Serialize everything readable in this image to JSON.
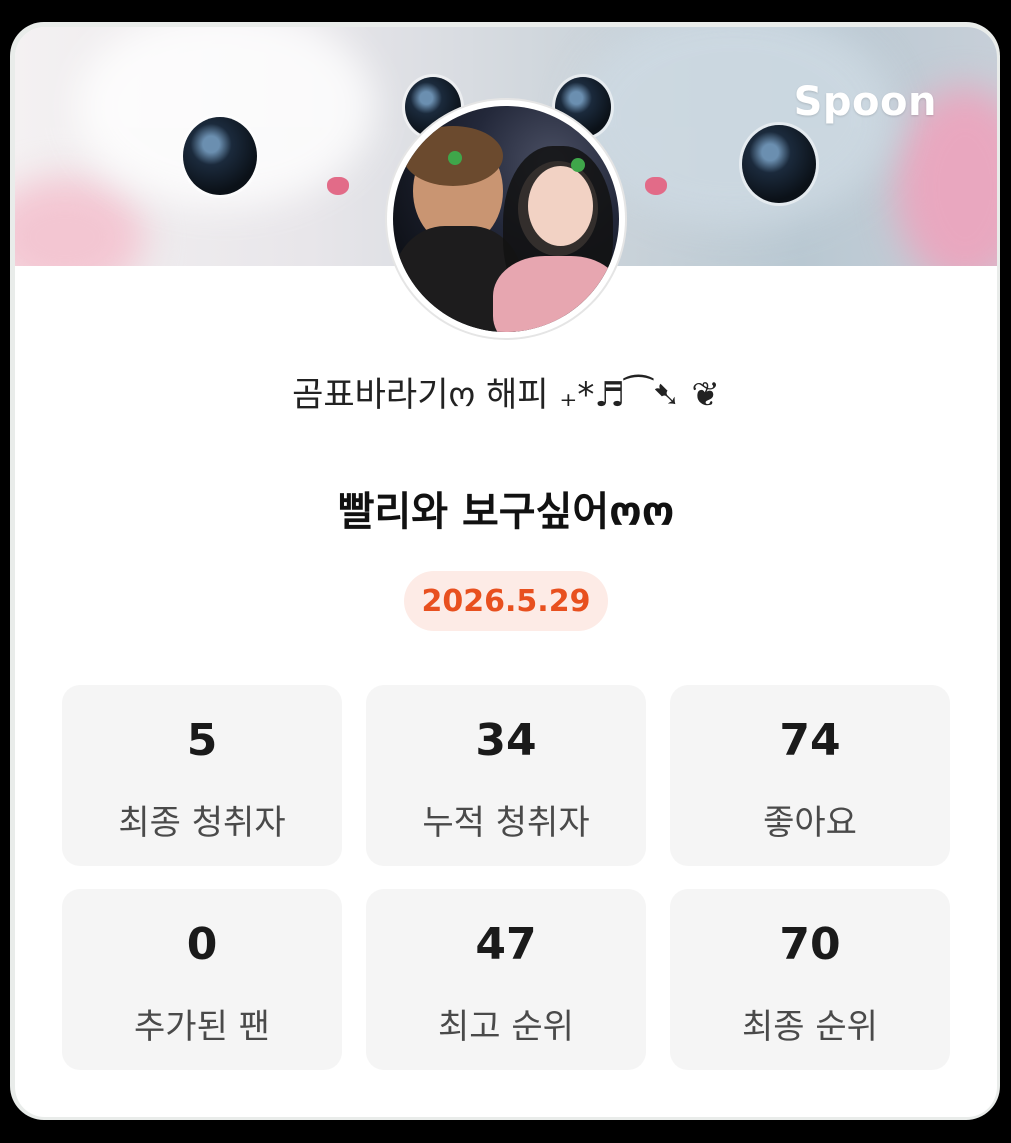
{
  "brand": {
    "logo_text": "Spoon"
  },
  "broadcast": {
    "host_name": "곰표바라기ო 해피 ₊*♬⁀➷ ❦",
    "title": "빨리와 보구싶어ოო",
    "date": "2026.5.29"
  },
  "stats": [
    {
      "value": "5",
      "label": "최종 청취자"
    },
    {
      "value": "34",
      "label": "누적 청취자"
    },
    {
      "value": "74",
      "label": "좋아요"
    },
    {
      "value": "0",
      "label": "추가된 팬"
    },
    {
      "value": "47",
      "label": "최고 순위"
    },
    {
      "value": "70",
      "label": "최종 순위"
    }
  ],
  "colors": {
    "accent": "#e8501f",
    "badge_bg": "#fdebe6",
    "stat_bg": "#f5f5f5",
    "page_bg": "#000000"
  },
  "icons": {
    "avatar": "profile-photo",
    "banner": "bunny-banner-image"
  }
}
